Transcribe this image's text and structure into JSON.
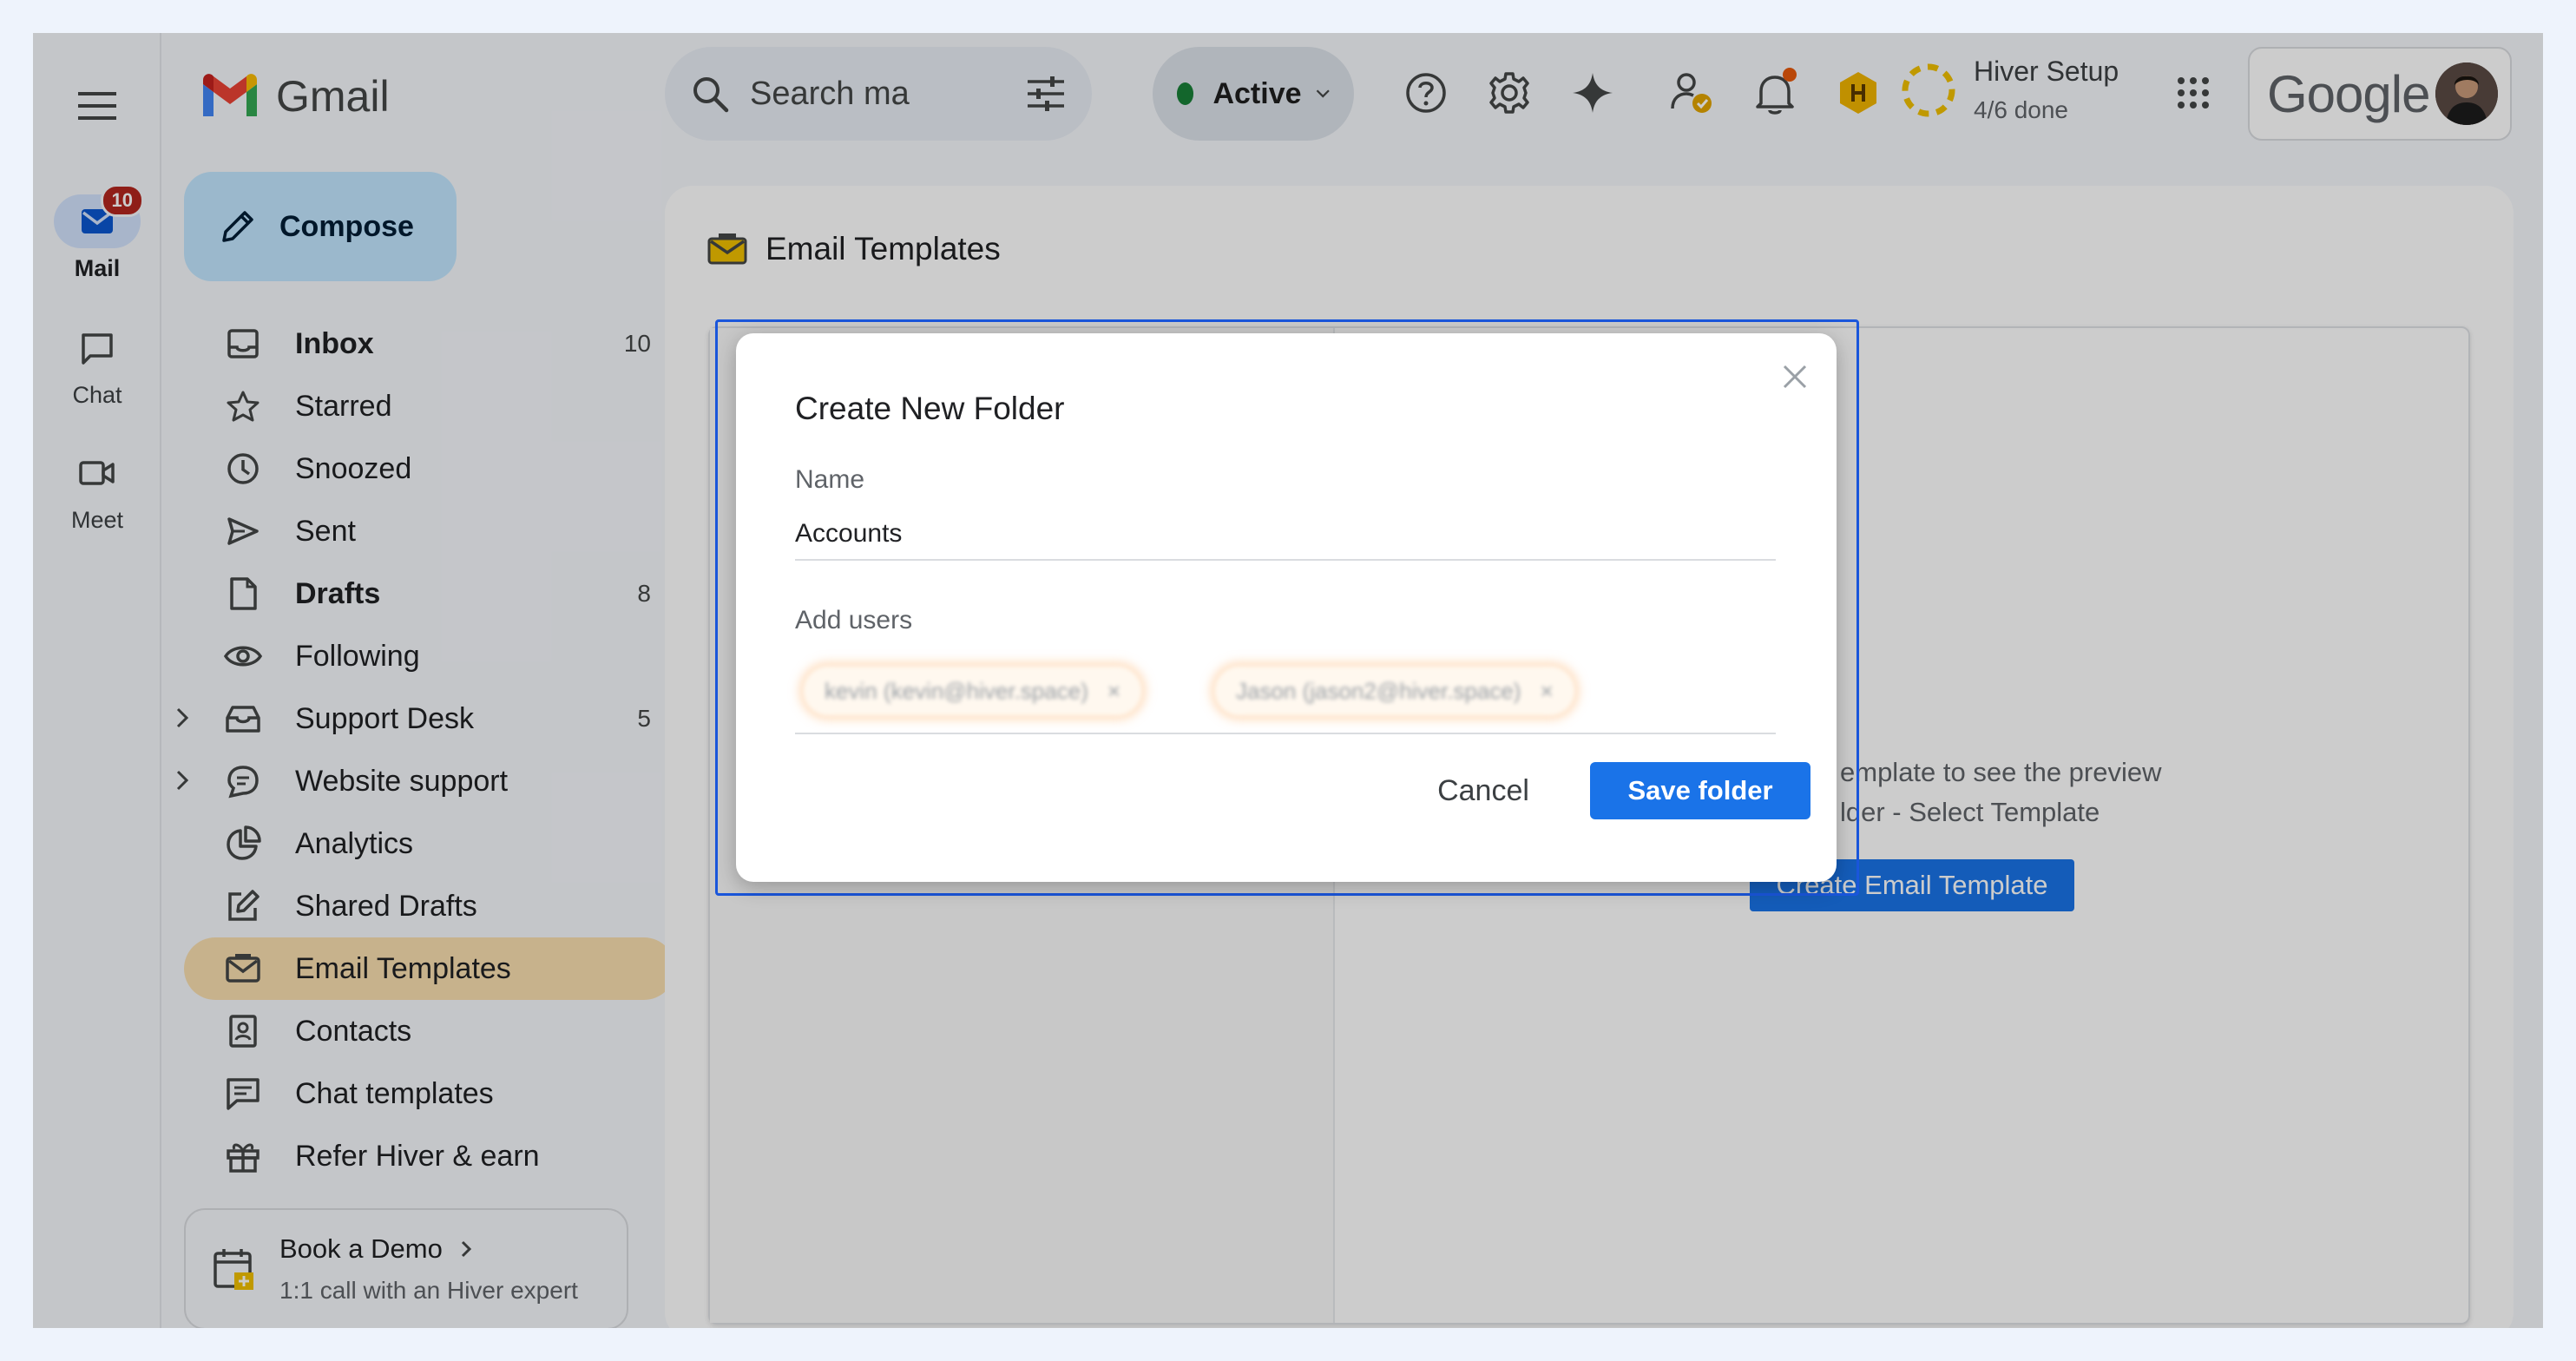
{
  "rail": {
    "mail_label": "Mail",
    "mail_badge": "10",
    "chat_label": "Chat",
    "meet_label": "Meet"
  },
  "header": {
    "app_name": "Gmail",
    "search_placeholder": "Search ma",
    "status_label": "Active",
    "setup_title": "Hiver Setup",
    "setup_progress": "4/6 done",
    "account_brand": "Google"
  },
  "sidebar": {
    "compose_label": "Compose",
    "items": [
      {
        "label": "Inbox",
        "count": "10",
        "icon": "inbox-icon",
        "bold": true
      },
      {
        "label": "Starred",
        "count": "",
        "icon": "star-icon"
      },
      {
        "label": "Snoozed",
        "count": "",
        "icon": "clock-icon"
      },
      {
        "label": "Sent",
        "count": "",
        "icon": "send-icon"
      },
      {
        "label": "Drafts",
        "count": "8",
        "icon": "draft-icon",
        "bold": true
      },
      {
        "label": "Following",
        "count": "",
        "icon": "eye-icon"
      },
      {
        "label": "Support Desk",
        "count": "5",
        "icon": "shared-inbox-icon",
        "expandable": true
      },
      {
        "label": "Website support",
        "count": "",
        "icon": "chat-bubble-icon",
        "expandable": true
      },
      {
        "label": "Analytics",
        "count": "",
        "icon": "pie-chart-icon"
      },
      {
        "label": "Shared Drafts",
        "count": "",
        "icon": "edit-icon"
      },
      {
        "label": "Email Templates",
        "count": "",
        "icon": "template-icon",
        "active": true
      },
      {
        "label": "Contacts",
        "count": "",
        "icon": "contacts-icon"
      },
      {
        "label": "Chat templates",
        "count": "",
        "icon": "chat-template-icon"
      },
      {
        "label": "Refer Hiver & earn",
        "count": "",
        "icon": "gift-icon"
      }
    ],
    "demo_title": "Book a Demo",
    "demo_subtitle": "1:1 call with an Hiver expert"
  },
  "content": {
    "page_title": "Email Templates",
    "empty_line_1": "emplate to see the preview",
    "empty_line_2": "lder - Select Template",
    "create_button": "Create Email Template"
  },
  "modal": {
    "title": "Create New Folder",
    "name_label": "Name",
    "name_value": "Accounts",
    "users_label": "Add users",
    "user_chips": [
      "kevin (kevin@hiver.space)",
      "Jason (jason2@hiver.space)"
    ],
    "cancel_label": "Cancel",
    "save_label": "Save folder"
  },
  "colors": {
    "accent": "#1a73e8",
    "active_nav": "#f9dfb0",
    "compose_bg": "#c2e7ff",
    "status_green": "#188038",
    "badge_red": "#b3261e"
  }
}
